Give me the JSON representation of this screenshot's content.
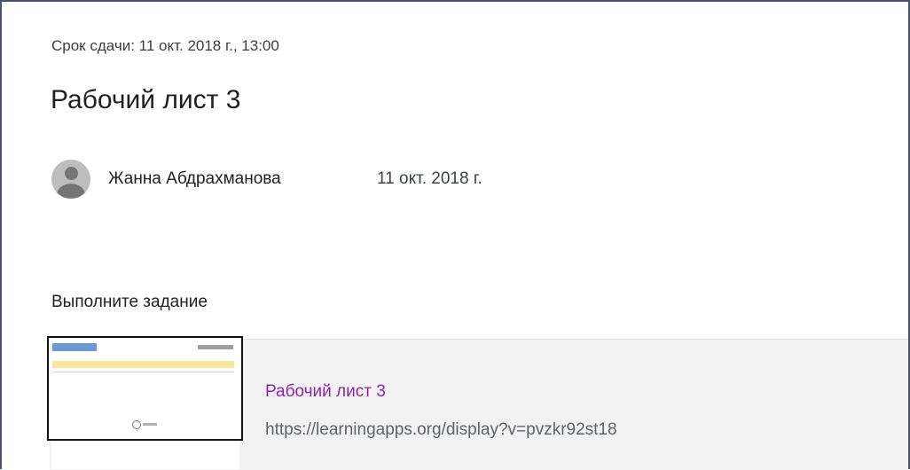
{
  "assignment": {
    "due": "Срок сдачи: 11 окт. 2018 г., 13:00",
    "title": "Рабочий лист 3",
    "author": "Жанна Абдрахманова",
    "date": "11 окт. 2018 г.",
    "instructions": "Выполните задание"
  },
  "attachment": {
    "title": "Рабочий лист 3",
    "url": "https://learningapps.org/display?v=pvzkr92st18"
  },
  "colors": {
    "link_title": "#8e24aa",
    "url": "#5f6368",
    "attachment_bg": "#f2f2f2"
  },
  "icons": {
    "avatar": "person-avatar-icon"
  }
}
